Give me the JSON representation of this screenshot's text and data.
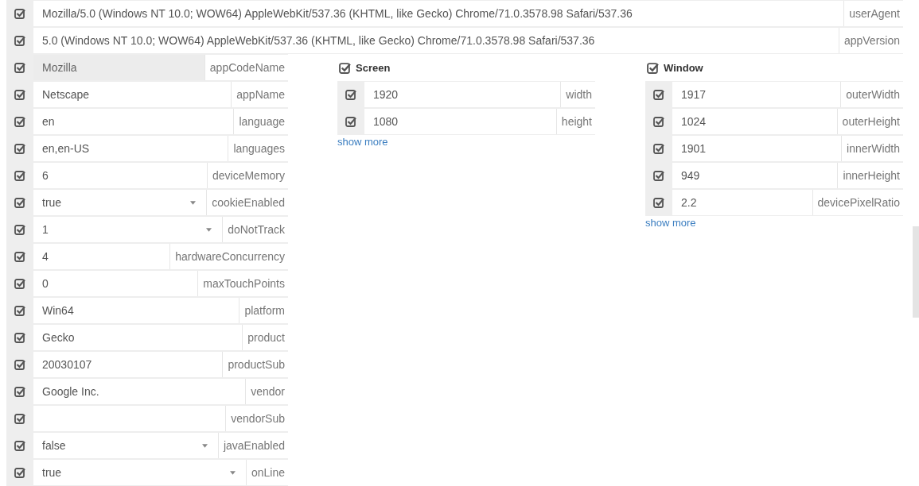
{
  "top_rows": [
    {
      "checked": true,
      "disabled": false,
      "value": "Mozilla/5.0 (Windows NT 10.0; WOW64) AppleWebKit/537.36 (KHTML, like Gecko) Chrome/71.0.3578.98 Safari/537.36",
      "label": "userAgent"
    },
    {
      "checked": true,
      "disabled": false,
      "value": "5.0 (Windows NT 10.0; WOW64) AppleWebKit/537.36 (KHTML, like Gecko) Chrome/71.0.3578.98 Safari/537.36",
      "label": "appVersion"
    }
  ],
  "navigator_rows": [
    {
      "kind": "text",
      "checked": true,
      "disabled": true,
      "value": "Mozilla",
      "label": "appCodeName"
    },
    {
      "kind": "text",
      "checked": true,
      "disabled": false,
      "value": "Netscape",
      "label": "appName"
    },
    {
      "kind": "text",
      "checked": true,
      "disabled": false,
      "value": "en",
      "label": "language"
    },
    {
      "kind": "text",
      "checked": true,
      "disabled": false,
      "value": "en,en-US",
      "label": "languages"
    },
    {
      "kind": "text",
      "checked": true,
      "disabled": false,
      "value": "6",
      "label": "deviceMemory"
    },
    {
      "kind": "select",
      "checked": true,
      "disabled": false,
      "value": "true",
      "label": "cookieEnabled"
    },
    {
      "kind": "select",
      "checked": true,
      "disabled": false,
      "value": "1",
      "label": "doNotTrack"
    },
    {
      "kind": "text",
      "checked": true,
      "disabled": false,
      "value": "4",
      "label": "hardwareConcurrency"
    },
    {
      "kind": "text",
      "checked": true,
      "disabled": false,
      "value": "0",
      "label": "maxTouchPoints"
    },
    {
      "kind": "text",
      "checked": true,
      "disabled": false,
      "value": "Win64",
      "label": "platform"
    },
    {
      "kind": "text",
      "checked": true,
      "disabled": false,
      "value": "Gecko",
      "label": "product"
    },
    {
      "kind": "text",
      "checked": true,
      "disabled": false,
      "value": "20030107",
      "label": "productSub"
    },
    {
      "kind": "text",
      "checked": true,
      "disabled": false,
      "value": "Google Inc.",
      "label": "vendor"
    },
    {
      "kind": "text",
      "checked": true,
      "disabled": false,
      "value": "",
      "label": "vendorSub"
    },
    {
      "kind": "select",
      "checked": true,
      "disabled": false,
      "value": "false",
      "label": "javaEnabled"
    },
    {
      "kind": "select",
      "checked": true,
      "disabled": false,
      "value": "true",
      "label": "onLine"
    }
  ],
  "sections": [
    {
      "title": "Screen",
      "checked": true,
      "rows": [
        {
          "checked": true,
          "disabled": false,
          "value": "1920",
          "label": "width"
        },
        {
          "checked": true,
          "disabled": false,
          "value": "1080",
          "label": "height"
        }
      ],
      "link": "show more"
    },
    {
      "title": "Window",
      "checked": true,
      "rows": [
        {
          "checked": true,
          "disabled": false,
          "value": "1917",
          "label": "outerWidth"
        },
        {
          "checked": true,
          "disabled": false,
          "value": "1024",
          "label": "outerHeight"
        },
        {
          "checked": true,
          "disabled": false,
          "value": "1901",
          "label": "innerWidth"
        },
        {
          "checked": true,
          "disabled": false,
          "value": "949",
          "label": "innerHeight"
        },
        {
          "checked": true,
          "disabled": false,
          "value": "2.2",
          "label": "devicePixelRatio"
        }
      ],
      "link": "show more"
    }
  ]
}
